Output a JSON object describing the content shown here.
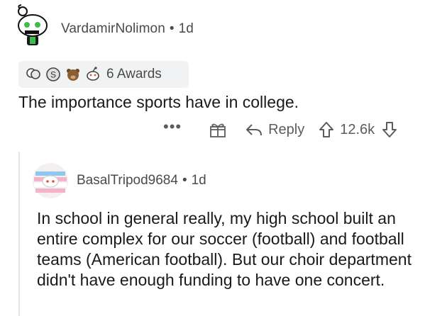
{
  "comment": {
    "username": "VardamirNolimon",
    "separator": "•",
    "age": "1d",
    "awards_label": "6 Awards",
    "body": "The importance sports have in college.",
    "actions": {
      "more": "•••",
      "reply_label": "Reply",
      "score": "12.6k"
    }
  },
  "reply": {
    "username": "BasalTripod9684",
    "separator": "•",
    "age": "1d",
    "body": "In school in general really, my high school built an entire complex for our soccer (football) and football teams (American football). But our choir department didn't have enough funding to have one concert."
  }
}
